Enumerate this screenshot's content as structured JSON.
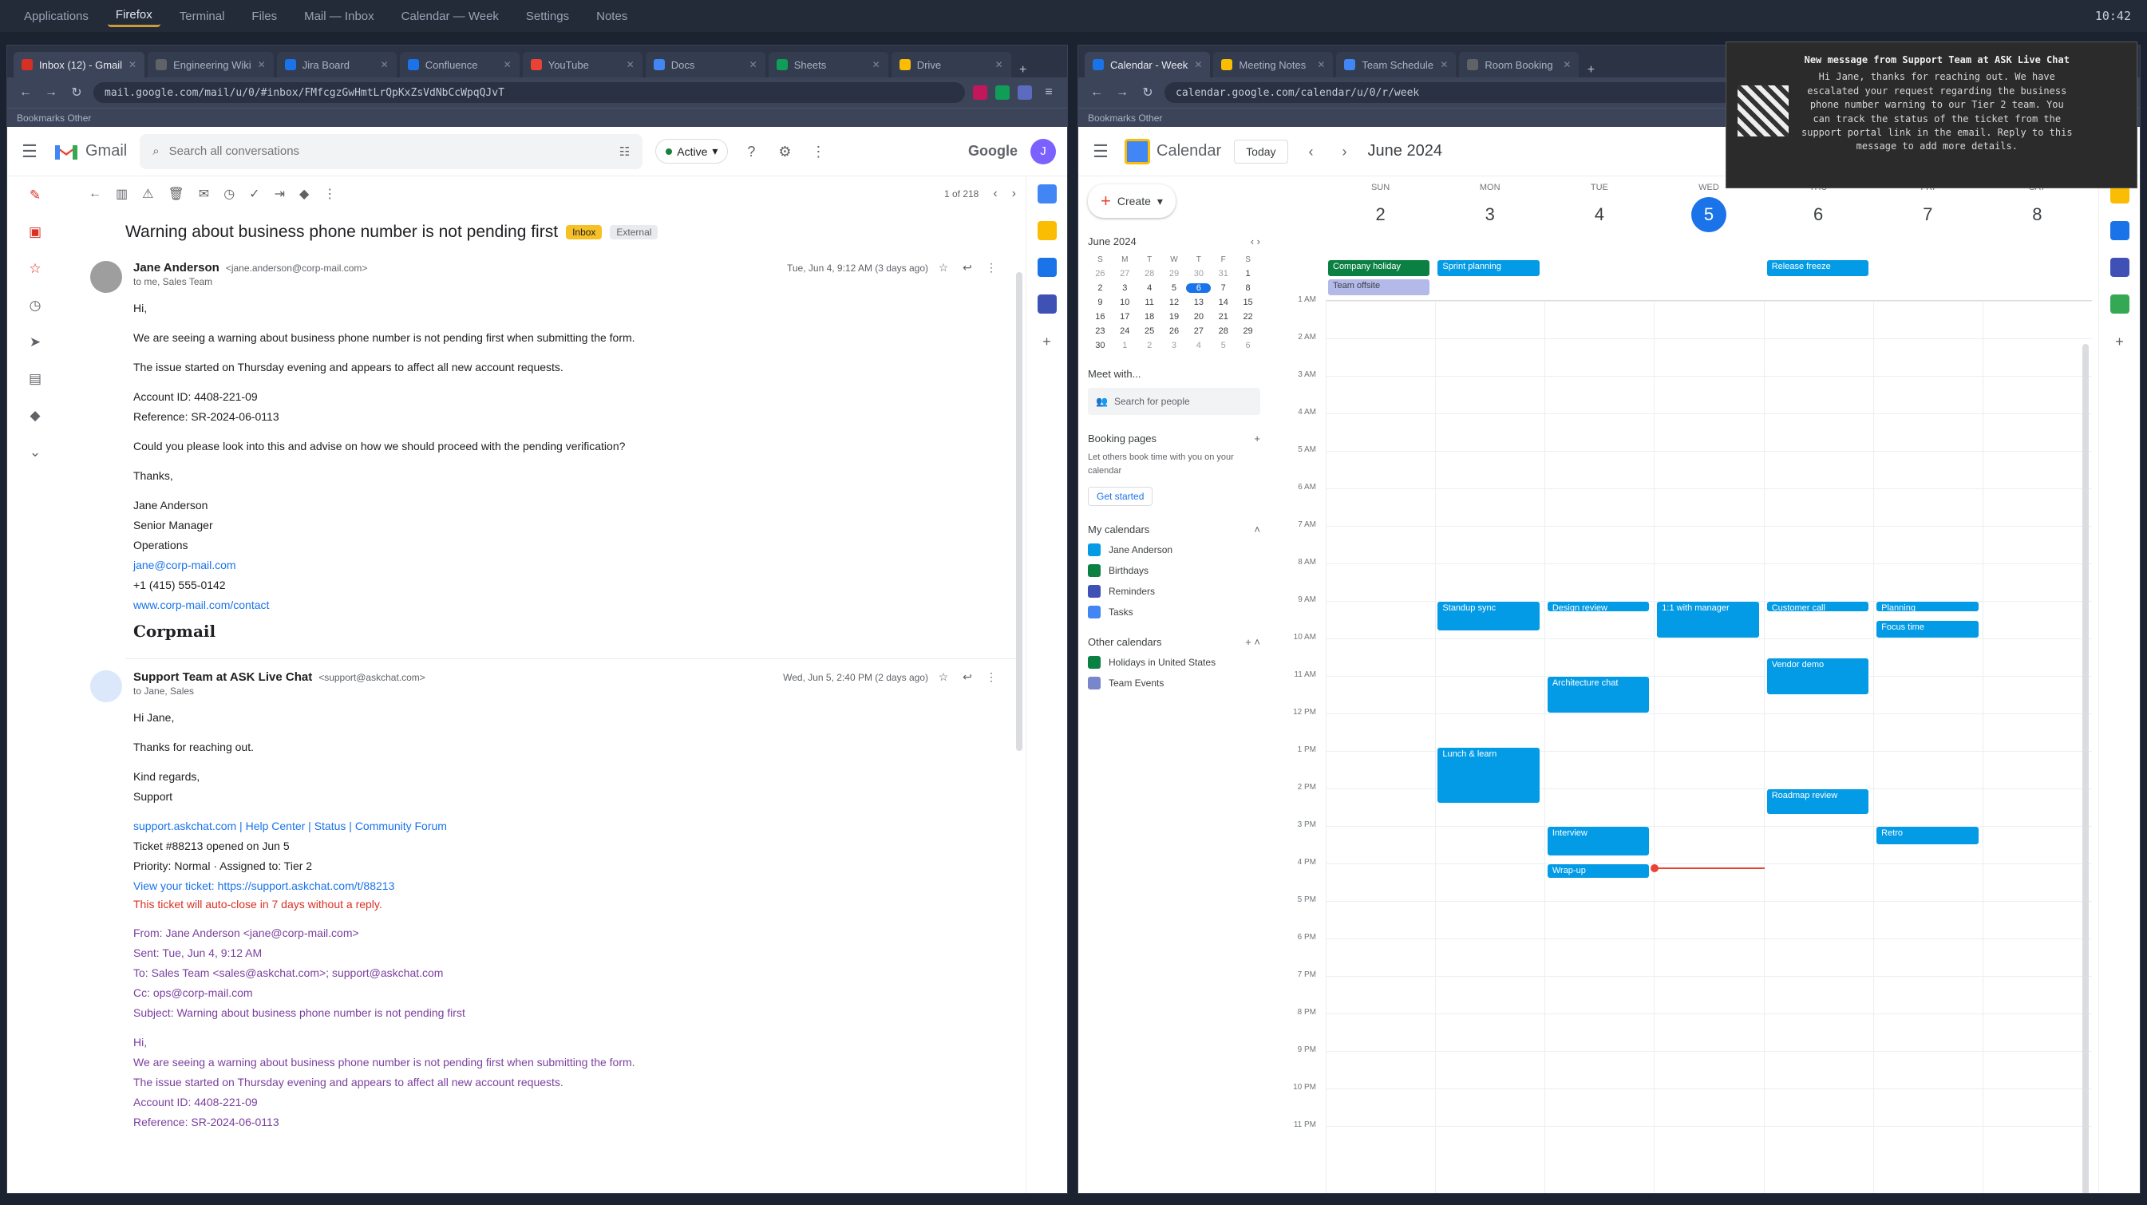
{
  "taskbar": {
    "items": [
      "Applications",
      "Firefox",
      "Terminal",
      "Files",
      "Mail — Inbox",
      "Calendar — Week",
      "Settings",
      "Notes"
    ],
    "clock": "10:42"
  },
  "gmail_window": {
    "tabs": [
      {
        "label": "Inbox (12) - Gmail",
        "color": "#d93025"
      },
      {
        "label": "Engineering Wiki",
        "color": "#5f6368"
      },
      {
        "label": "Jira Board",
        "color": "#1a73e8"
      },
      {
        "label": "Confluence",
        "color": "#1a73e8"
      },
      {
        "label": "YouTube",
        "color": "#ea4335"
      },
      {
        "label": "Docs",
        "color": "#4285f4"
      },
      {
        "label": "Sheets",
        "color": "#0f9d58"
      },
      {
        "label": "Drive",
        "color": "#fbbc04"
      }
    ],
    "url": "mail.google.com/mail/u/0/#inbox/FMfcgzGwHmtLrQpKxZsVdNbCcWpqQJvT",
    "bookmarks": "Bookmarks   Other",
    "product": "Gmail",
    "search_placeholder": "Search all conversations",
    "status": "Active",
    "org": "Google",
    "avatar": "J",
    "pager": "1 of 218",
    "subject": "Warning about business phone number is not pending first",
    "label": "Inbox",
    "label2": "External",
    "messages": [
      {
        "sender": "Jane Anderson",
        "email": "<jane.anderson@corp-mail.com>",
        "to": "to me, Sales Team",
        "time": "Tue, Jun 4, 9:12 AM (3 days ago)",
        "lines": [
          "Hi,",
          "We are seeing a warning about business phone number is not pending first when submitting the form.",
          "The issue started on Thursday evening and appears to affect all new account requests.",
          "Account ID: 4408-221-09",
          "Reference: SR-2024-06-0113",
          "Could you please look into this and advise on how we should proceed with the pending verification?",
          "Thanks,",
          "Jane Anderson",
          "Senior Manager",
          "Operations",
          "jane@corp-mail.com",
          "+1 (415) 555-0142",
          "www.corp-mail.com/contact"
        ],
        "brand": "Corpmail"
      },
      {
        "sender": "Support Team at ASK Live Chat",
        "email": "<support@askchat.com>",
        "to": "to Jane, Sales",
        "time": "Wed, Jun 5, 2:40 PM (2 days ago)",
        "lines": [
          "Hi Jane,",
          "Thanks for reaching out.",
          "Kind regards,",
          "Support",
          "support.askchat.com | Help Center | Status | Community Forum",
          "Ticket #88213 opened on Jun 5",
          "Priority: Normal · Assigned to: Tier 2",
          "View your ticket: https://support.askchat.com/t/88213",
          "This ticket will auto-close in 7 days without a reply."
        ],
        "quoted": [
          "From: Jane Anderson <jane@corp-mail.com>",
          "Sent: Tue, Jun 4, 9:12 AM",
          "To: Sales Team <sales@askchat.com>; support@askchat.com",
          "Cc: ops@corp-mail.com",
          "Subject: Warning about business phone number is not pending first",
          "Hi,",
          "We are seeing a warning about business phone number is not pending first when submitting the form.",
          "The issue started on Thursday evening and appears to affect all new account requests.",
          "Account ID: 4408-221-09",
          "Reference: SR-2024-06-0113"
        ]
      }
    ]
  },
  "calendar_window": {
    "tabs": [
      {
        "label": "Calendar - Week",
        "color": "#1a73e8"
      },
      {
        "label": "Meeting Notes",
        "color": "#fbbc04"
      },
      {
        "label": "Team Schedule",
        "color": "#4285f4"
      },
      {
        "label": "Room Booking",
        "color": "#5f6368"
      }
    ],
    "url": "calendar.google.com/calendar/u/0/r/week",
    "bookmarks": "Bookmarks   Other",
    "product": "Calendar",
    "today_label": "Today",
    "month_title": "June 2024",
    "create_label": "Create",
    "mini": {
      "title": "June 2024",
      "dow": [
        "S",
        "M",
        "T",
        "W",
        "T",
        "F",
        "S"
      ],
      "weeks": [
        [
          "26",
          "27",
          "28",
          "29",
          "30",
          "31",
          "1"
        ],
        [
          "2",
          "3",
          "4",
          "5",
          "6",
          "7",
          "8"
        ],
        [
          "9",
          "10",
          "11",
          "12",
          "13",
          "14",
          "15"
        ],
        [
          "16",
          "17",
          "18",
          "19",
          "20",
          "21",
          "22"
        ],
        [
          "23",
          "24",
          "25",
          "26",
          "27",
          "28",
          "29"
        ],
        [
          "30",
          "1",
          "2",
          "3",
          "4",
          "5",
          "6"
        ]
      ],
      "today": "6"
    },
    "meet_label": "Meet with...",
    "search_people": "Search for people",
    "booking_label": "Booking pages",
    "booking_text": "Let others book time with you on your calendar",
    "booking_link": "Get started",
    "my_cal_label": "My calendars",
    "my_calendars": [
      {
        "name": "Jane Anderson",
        "color": "#039be5"
      },
      {
        "name": "Birthdays",
        "color": "#0b8043"
      },
      {
        "name": "Reminders",
        "color": "#3f51b5"
      },
      {
        "name": "Tasks",
        "color": "#4285f4"
      }
    ],
    "other_cal_label": "Other calendars",
    "other_calendars": [
      {
        "name": "Holidays in United States",
        "color": "#0b8043"
      },
      {
        "name": "Team Events",
        "color": "#7986cb"
      }
    ],
    "days": [
      {
        "dow": "SUN",
        "num": "2"
      },
      {
        "dow": "MON",
        "num": "3"
      },
      {
        "dow": "TUE",
        "num": "4"
      },
      {
        "dow": "WED",
        "num": "5"
      },
      {
        "dow": "THU",
        "num": "6"
      },
      {
        "dow": "FRI",
        "num": "7"
      },
      {
        "dow": "SAT",
        "num": "8"
      }
    ],
    "today_index": 3,
    "hours": [
      "1 AM",
      "2 AM",
      "3 AM",
      "4 AM",
      "5 AM",
      "6 AM",
      "7 AM",
      "8 AM",
      "9 AM",
      "10 AM",
      "11 AM",
      "12 PM",
      "1 PM",
      "2 PM",
      "3 PM",
      "4 PM",
      "5 PM",
      "6 PM",
      "7 PM",
      "8 PM",
      "9 PM",
      "10 PM",
      "11 PM"
    ],
    "allday_events": [
      {
        "label": "Company holiday",
        "day": 0,
        "style": "green",
        "row": 0
      },
      {
        "label": "Team offsite",
        "day": 0,
        "style": "lav",
        "row": 1
      },
      {
        "label": "Sprint planning",
        "day": 1,
        "style": "blue",
        "row": 0
      },
      {
        "label": "Release freeze",
        "day": 4,
        "style": "blue",
        "row": 0
      }
    ],
    "events": [
      {
        "label": "Standup sync",
        "day": 1,
        "start": 9.0,
        "end": 9.8
      },
      {
        "label": "Design review",
        "day": 2,
        "start": 9.0,
        "end": 9.3
      },
      {
        "label": "1:1 with manager",
        "day": 3,
        "start": 9.0,
        "end": 10.0
      },
      {
        "label": "Customer call",
        "day": 4,
        "start": 9.0,
        "end": 9.3
      },
      {
        "label": "Planning",
        "day": 5,
        "start": 9.0,
        "end": 9.3
      },
      {
        "label": "Focus time",
        "day": 5,
        "start": 9.5,
        "end": 10.0
      },
      {
        "label": "Architecture chat",
        "day": 2,
        "start": 11.0,
        "end": 12.0
      },
      {
        "label": "Vendor demo",
        "day": 4,
        "start": 10.5,
        "end": 11.5
      },
      {
        "label": "Lunch & learn",
        "day": 1,
        "start": 12.9,
        "end": 14.4
      },
      {
        "label": "Roadmap review",
        "day": 4,
        "start": 14.0,
        "end": 14.7
      },
      {
        "label": "Interview",
        "day": 2,
        "start": 15.0,
        "end": 15.8
      },
      {
        "label": "Retro",
        "day": 5,
        "start": 15.0,
        "end": 15.5
      },
      {
        "label": "Wrap-up",
        "day": 2,
        "start": 16.0,
        "end": 16.4
      }
    ],
    "now": {
      "day": 3,
      "hour": 16.1
    }
  },
  "notification": {
    "title": "New message from Support Team at ASK Live Chat",
    "lines": [
      "Hi Jane, thanks for reaching out. We have",
      "escalated your request regarding the business",
      "phone number warning to our Tier 2 team. You",
      "can track the status of the ticket from the",
      "support portal link in the email. Reply to this",
      "message to add more details."
    ]
  }
}
